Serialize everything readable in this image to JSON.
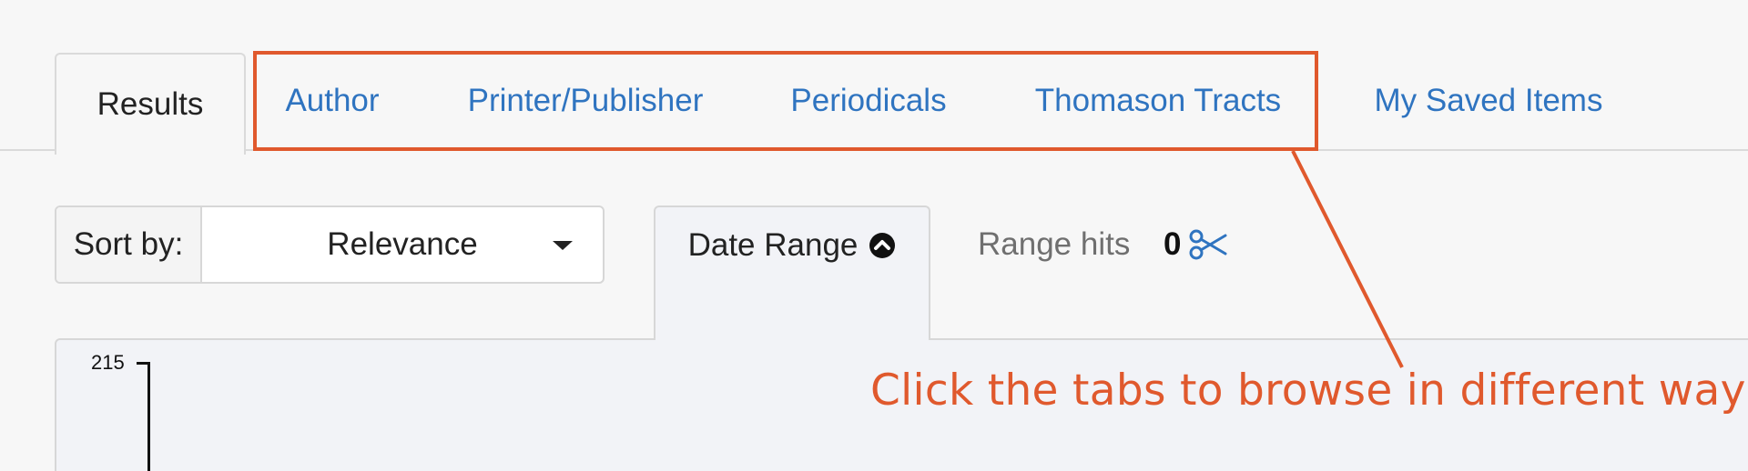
{
  "tabs": [
    {
      "label": "Results",
      "active": true
    },
    {
      "label": "Author",
      "active": false
    },
    {
      "label": "Printer/Publisher",
      "active": false
    },
    {
      "label": "Periodicals",
      "active": false
    },
    {
      "label": "Thomason Tracts",
      "active": false
    },
    {
      "label": "My Saved Items",
      "active": false
    }
  ],
  "sort": {
    "label": "Sort by:",
    "selected": "Relevance"
  },
  "date_range": {
    "label": "Date Range",
    "icon": "chevron-up-circle-icon"
  },
  "range_hits": {
    "label": "Range hits",
    "count": "0",
    "icon": "scissors-icon"
  },
  "chart": {
    "y_max_label": "215"
  },
  "annotation": {
    "text": "Click the tabs to browse in different ways",
    "color": "#e0592d"
  },
  "colors": {
    "link": "#2f74c0",
    "accent": "#e0592d",
    "background": "#f7f7f7"
  }
}
